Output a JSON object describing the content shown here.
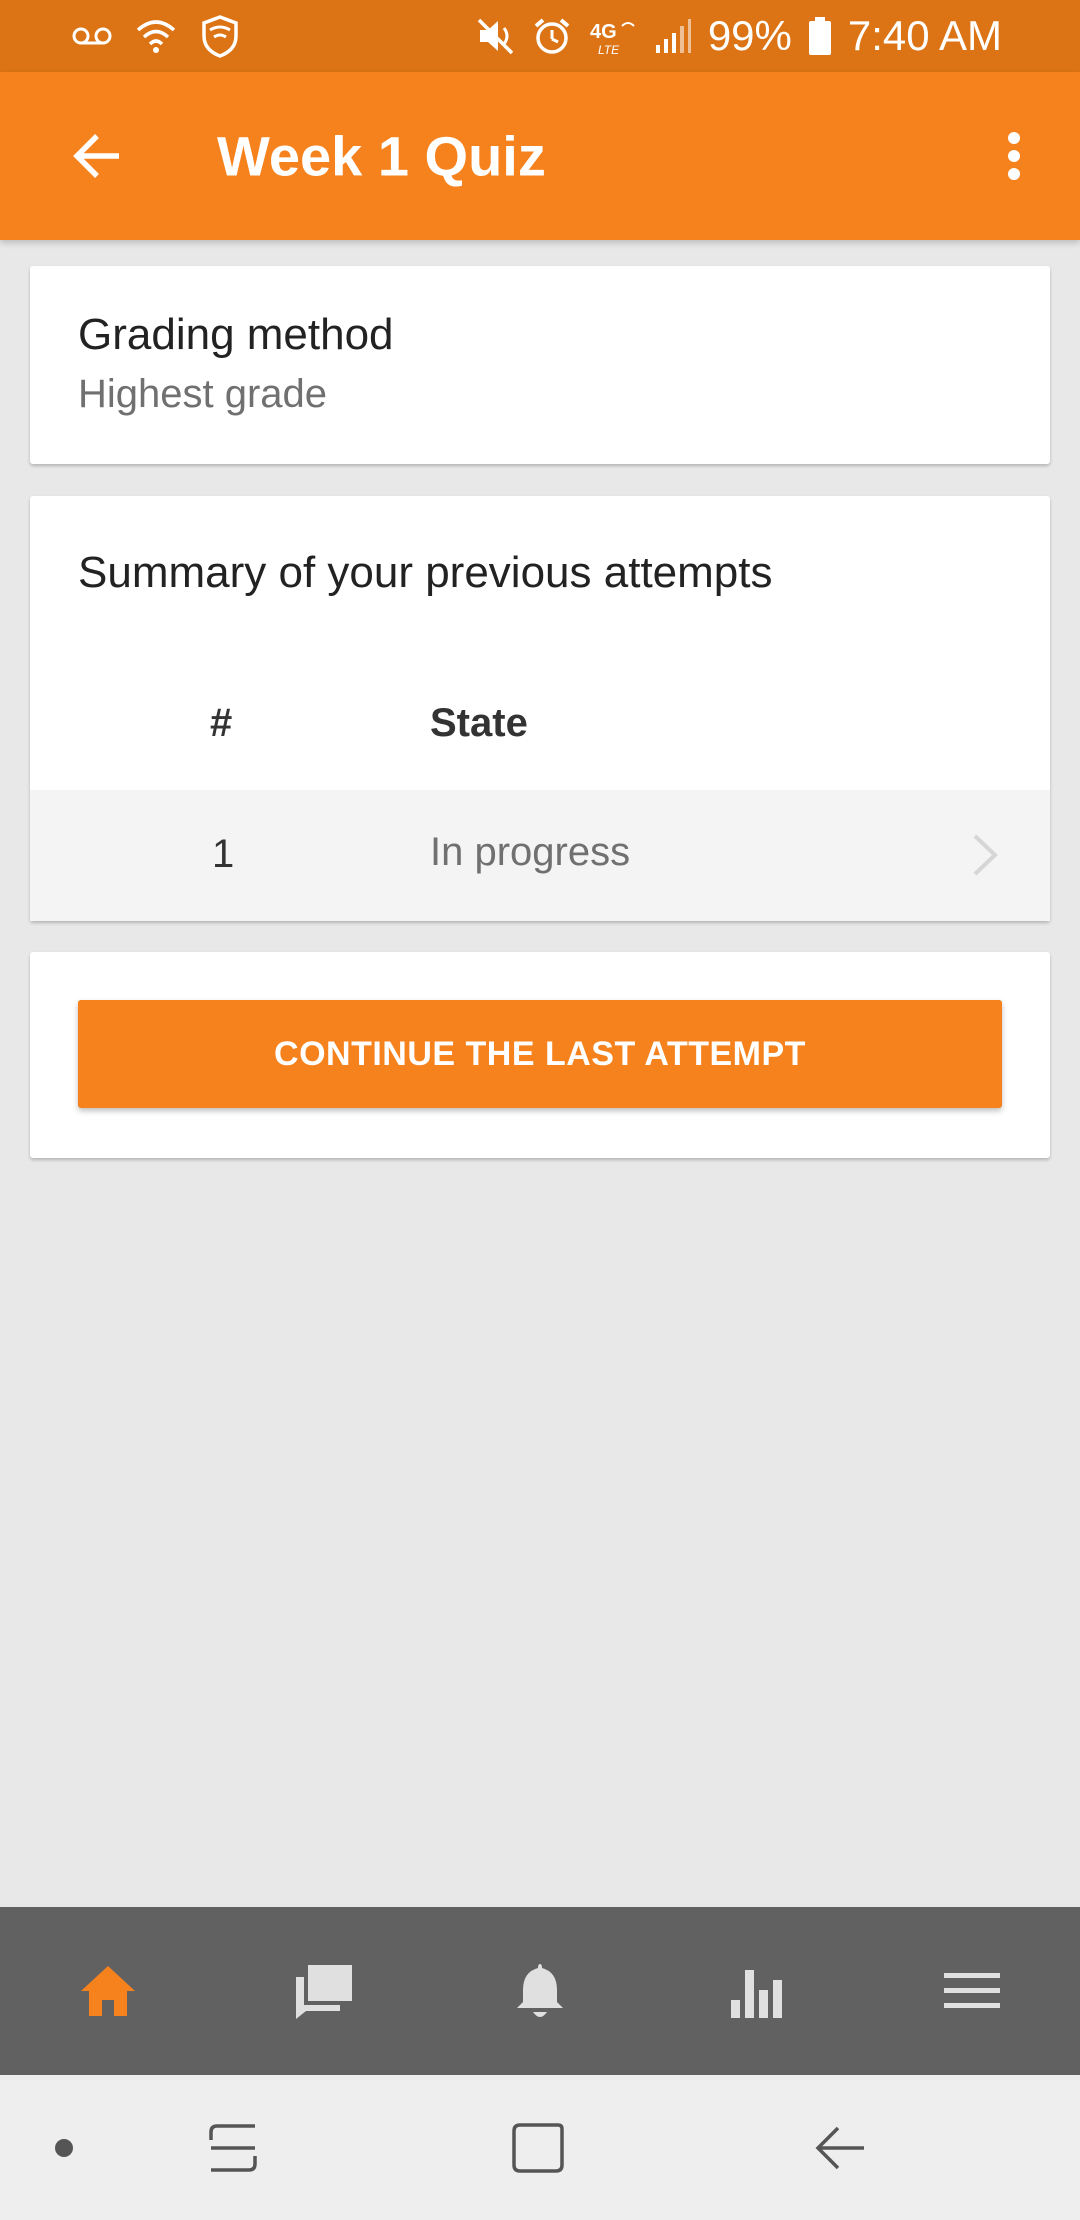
{
  "status_bar": {
    "battery_percent": "99%",
    "time": "7:40 AM",
    "network_label": "4G"
  },
  "app_bar": {
    "title": "Week 1 Quiz"
  },
  "grading": {
    "title": "Grading method",
    "value": "Highest grade"
  },
  "summary": {
    "title": "Summary of your previous attempts",
    "columns": [
      "#",
      "State"
    ],
    "rows": [
      {
        "number": "1",
        "state": "In progress"
      }
    ]
  },
  "action": {
    "continue_label": "CONTINUE THE LAST ATTEMPT"
  },
  "bottom_nav": {
    "items": [
      {
        "icon": "home-icon",
        "active": true
      },
      {
        "icon": "messages-icon",
        "active": false
      },
      {
        "icon": "notifications-icon",
        "active": false
      },
      {
        "icon": "grades-icon",
        "active": false
      },
      {
        "icon": "menu-icon",
        "active": false
      }
    ]
  },
  "colors": {
    "accent": "#f6821d",
    "status_bar": "#dc7415",
    "bottom_nav_bg": "#616161",
    "page_bg": "#e8e8e8"
  }
}
